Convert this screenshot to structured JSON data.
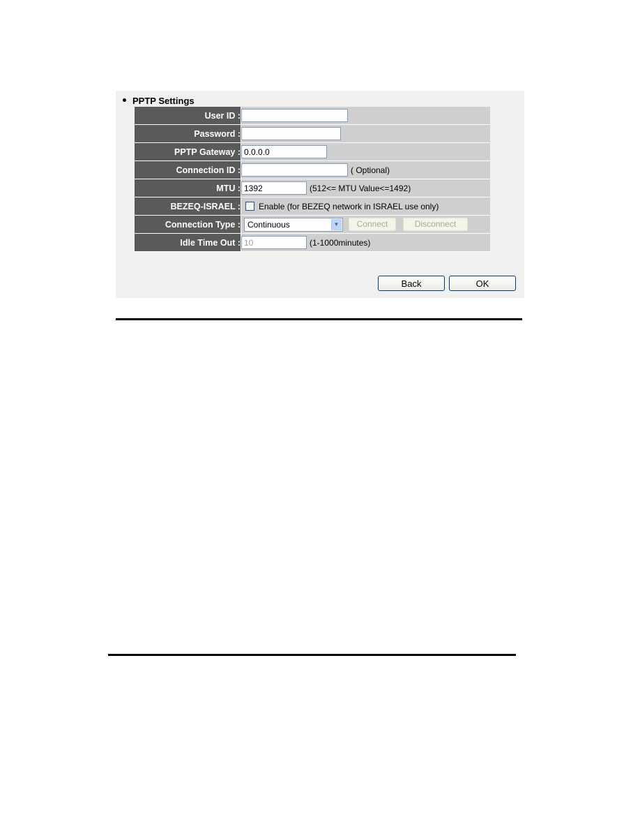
{
  "section": {
    "title": "PPTP Settings"
  },
  "fields": {
    "user_id": {
      "label": "User ID :",
      "value": ""
    },
    "password": {
      "label": "Password :",
      "value": ""
    },
    "pptp_gateway": {
      "label": "PPTP Gateway :",
      "value": "0.0.0.0"
    },
    "connection_id": {
      "label": "Connection ID :",
      "value": "",
      "hint": "( Optional)"
    },
    "mtu": {
      "label": "MTU :",
      "value": "1392",
      "hint": "(512<= MTU Value<=1492)"
    },
    "bezeq_israel": {
      "label": "BEZEQ-ISRAEL :",
      "checked": false,
      "text": "Enable (for BEZEQ network in ISRAEL use only)"
    },
    "connection_type": {
      "label": "Connection Type :",
      "selected": "Continuous",
      "connect_label": "Connect",
      "disconnect_label": "Disconnect"
    },
    "idle_time_out": {
      "label": "Idle Time Out :",
      "value": "10",
      "hint": "(1-1000minutes)"
    }
  },
  "actions": {
    "back_label": "Back",
    "ok_label": "OK"
  }
}
